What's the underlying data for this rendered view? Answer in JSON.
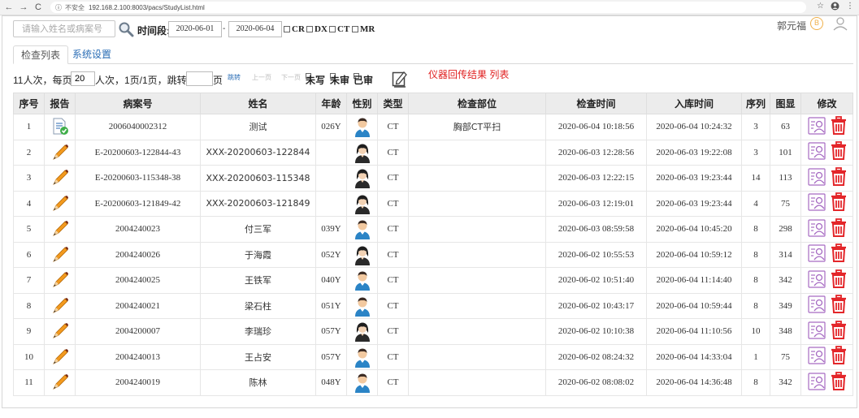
{
  "browser": {
    "back": "←",
    "forward": "→",
    "reload": "C",
    "info": "ⓘ",
    "insecure": "不安全",
    "url": "192.168.2.100:8003/pacs/StudyList.html",
    "star": "☆",
    "menu": "⋮"
  },
  "search": {
    "placeholder": "请输入姓名或病案号",
    "period_label": "时间段:",
    "date_from": "2020-06-01",
    "date_sep": "-",
    "date_to": "2020-06-04",
    "modalities": [
      "CR",
      "DX",
      "CT",
      "MR"
    ]
  },
  "user": {
    "name": "郭元福",
    "coin": "B"
  },
  "tabs": [
    {
      "label": "检查列表",
      "active": true
    },
    {
      "label": "系统设置",
      "active": false
    }
  ],
  "pager": {
    "summary": "11人次，每页",
    "page_size": "20",
    "per_page_suffix": "人次，1页/1页，跳转到",
    "jump_value": "",
    "page_unit": "页",
    "jump": "跳转",
    "prev": "上一页",
    "next": "下一页",
    "filter_unwritten": "未写",
    "filter_unreviewed": "未审",
    "filter_reviewed": "已审",
    "note": "仪器回传结果 列表"
  },
  "table": {
    "headers": [
      "序号",
      "报告",
      "病案号",
      "姓名",
      "年龄",
      "性别",
      "类型",
      "检查部位",
      "检查时间",
      "入库时间",
      "序列",
      "图显",
      "修改"
    ],
    "rows": [
      {
        "no": "1",
        "report": "done",
        "case_no": "2006040002312",
        "name": "测试",
        "age": "026Y",
        "gender": "male",
        "type": "CT",
        "part": "胸部CT平扫",
        "exam_time": "2020-06-04 10:18:56",
        "store_time": "2020-06-04 10:24:32",
        "series": "3",
        "images": "63"
      },
      {
        "no": "2",
        "report": "pending",
        "case_no": "E-20200603-122844-43",
        "name": "XXX-20200603-122844",
        "age": "",
        "gender": "female",
        "type": "CT",
        "part": "",
        "exam_time": "2020-06-03 12:28:56",
        "store_time": "2020-06-03 19:22:08",
        "series": "3",
        "images": "101"
      },
      {
        "no": "3",
        "report": "pending",
        "case_no": "E-20200603-115348-38",
        "name": "XXX-20200603-115348",
        "age": "",
        "gender": "female",
        "type": "CT",
        "part": "",
        "exam_time": "2020-06-03 12:22:15",
        "store_time": "2020-06-03 19:23:44",
        "series": "14",
        "images": "113"
      },
      {
        "no": "4",
        "report": "pending",
        "case_no": "E-20200603-121849-42",
        "name": "XXX-20200603-121849",
        "age": "",
        "gender": "female",
        "type": "CT",
        "part": "",
        "exam_time": "2020-06-03 12:19:01",
        "store_time": "2020-06-03 19:23:44",
        "series": "4",
        "images": "75"
      },
      {
        "no": "5",
        "report": "pending",
        "case_no": "2004240023",
        "name": "付三军",
        "age": "039Y",
        "gender": "male",
        "type": "CT",
        "part": "",
        "exam_time": "2020-06-03 08:59:58",
        "store_time": "2020-06-04 10:45:20",
        "series": "8",
        "images": "298"
      },
      {
        "no": "6",
        "report": "pending",
        "case_no": "2004240026",
        "name": "于海霞",
        "age": "052Y",
        "gender": "female",
        "type": "CT",
        "part": "",
        "exam_time": "2020-06-02 10:55:53",
        "store_time": "2020-06-04 10:59:12",
        "series": "8",
        "images": "314"
      },
      {
        "no": "7",
        "report": "pending",
        "case_no": "2004240025",
        "name": "王铁军",
        "age": "040Y",
        "gender": "male",
        "type": "CT",
        "part": "",
        "exam_time": "2020-06-02 10:51:40",
        "store_time": "2020-06-04 11:14:40",
        "series": "8",
        "images": "342"
      },
      {
        "no": "8",
        "report": "pending",
        "case_no": "2004240021",
        "name": "梁石柱",
        "age": "051Y",
        "gender": "male",
        "type": "CT",
        "part": "",
        "exam_time": "2020-06-02 10:43:17",
        "store_time": "2020-06-04 10:59:44",
        "series": "8",
        "images": "349"
      },
      {
        "no": "9",
        "report": "pending",
        "case_no": "2004200007",
        "name": "李瑞珍",
        "age": "057Y",
        "gender": "female",
        "type": "CT",
        "part": "",
        "exam_time": "2020-06-02 10:10:38",
        "store_time": "2020-06-04 11:10:56",
        "series": "10",
        "images": "348"
      },
      {
        "no": "10",
        "report": "pending",
        "case_no": "2004240013",
        "name": "王占安",
        "age": "057Y",
        "gender": "male",
        "type": "CT",
        "part": "",
        "exam_time": "2020-06-02 08:24:32",
        "store_time": "2020-06-04 14:33:04",
        "series": "1",
        "images": "75"
      },
      {
        "no": "11",
        "report": "pending",
        "case_no": "2004240019",
        "name": "陈林",
        "age": "048Y",
        "gender": "male",
        "type": "CT",
        "part": "",
        "exam_time": "2020-06-02 08:08:02",
        "store_time": "2020-06-04 14:36:48",
        "series": "8",
        "images": "342"
      }
    ]
  }
}
